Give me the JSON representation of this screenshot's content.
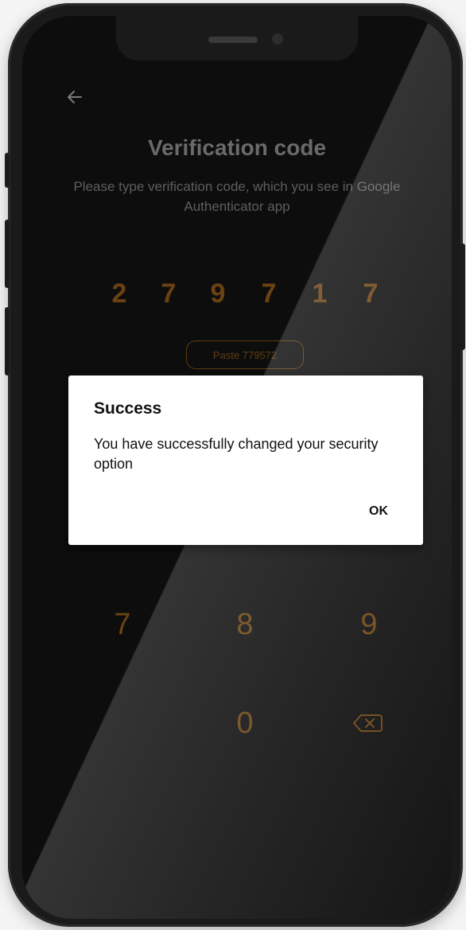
{
  "screen": {
    "title": "Verification code",
    "subtitle": "Please type verification code, which you see in Google Authenticator app",
    "back_icon": "arrow-left-icon"
  },
  "code": {
    "digits": [
      "2",
      "7",
      "9",
      "7",
      "1",
      "7"
    ]
  },
  "paste_button": {
    "label": "Paste 779572"
  },
  "keypad": {
    "keys": [
      "7",
      "8",
      "9",
      "0"
    ],
    "backspace_icon": "backspace-icon"
  },
  "dialog": {
    "title": "Success",
    "message": "You have successfully changed your security option",
    "ok_label": "OK"
  },
  "colors": {
    "accent": "#6b4312",
    "screen_background": "#0d0d0d",
    "dialog_background": "#ffffff"
  }
}
